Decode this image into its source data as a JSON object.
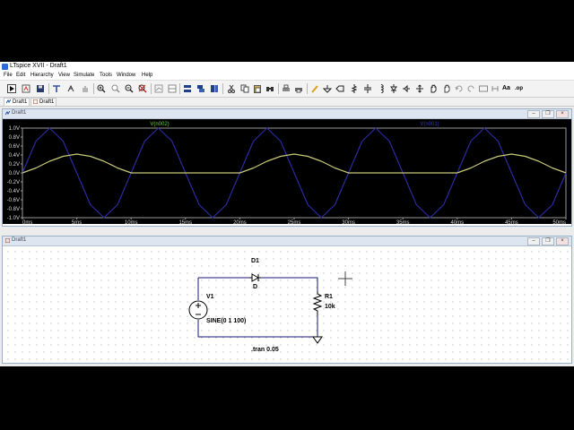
{
  "window": {
    "title": "LTspice XVII - Draft1",
    "brand_color": "#2b6cd4"
  },
  "menu": [
    "File",
    "Edit",
    "Hierarchy",
    "View",
    "Simulate",
    "Tools",
    "Window",
    "Help"
  ],
  "toolbar": {
    "icons": [
      "run-icon",
      "new-schematic-icon",
      "save-icon",
      "control-panel-icon",
      "halt-icon",
      "pan-icon",
      "zoom-in-icon",
      "zoom-area-icon",
      "zoom-out-icon",
      "zoom-fit-icon",
      "autorange-icon",
      "tile-horizontal-icon",
      "cascade-icon",
      "tile-vertical-icon",
      "cut-icon",
      "copy-icon",
      "paste-icon",
      "find-icon",
      "print-icon",
      "print-setup-icon",
      "draw-wire-icon",
      "ground-icon",
      "label-net-icon",
      "resistor-icon",
      "capacitor-icon",
      "inductor-icon",
      "diode-icon",
      "component-icon",
      "move-icon",
      "drag-icon",
      "undo-icon",
      "redo-icon",
      "rotate-icon",
      "mirror-icon",
      "text-icon",
      "spice-directive-icon"
    ],
    "text_glyphs": {
      "text": "Aa",
      "directive": ".op"
    }
  },
  "tabs": [
    "Draft1",
    "Draft1"
  ],
  "plot_window": {
    "title": "Draft1",
    "traces": [
      {
        "name": "V(n002)",
        "color": "#c8c878"
      },
      {
        "name": "V(n001)",
        "color": "#2a2aa0"
      }
    ],
    "background": "#000000"
  },
  "schematic_window": {
    "title": "Draft1",
    "components": {
      "diode_ref": "D1",
      "diode_model": "D",
      "source_ref": "V1",
      "source_value": "SINE(0 1 100)",
      "resistor_ref": "R1",
      "resistor_value": "10k"
    },
    "directive": ".tran 0.05"
  },
  "window_buttons": {
    "minimize": "–",
    "restore": "❐",
    "close": "×"
  },
  "chart_data": {
    "type": "line",
    "x": [
      0,
      1.25,
      2.5,
      3.75,
      5,
      6.25,
      7.5,
      8.75,
      10,
      11.25,
      12.5,
      13.75,
      15,
      16.25,
      17.5,
      18.75,
      20,
      21.25,
      22.5,
      23.75,
      25,
      26.25,
      27.5,
      28.75,
      30,
      31.25,
      32.5,
      33.75,
      35,
      36.25,
      37.5,
      38.75,
      40,
      41.25,
      42.5,
      43.75,
      45,
      46.25,
      47.5,
      48.75,
      50
    ],
    "xunit": "ms",
    "series": [
      {
        "name": "V(n002)",
        "color": "#c8c878",
        "values": [
          0,
          0.11,
          0.26,
          0.37,
          0.42,
          0.37,
          0.26,
          0.11,
          0,
          0,
          0,
          0,
          0,
          0,
          0,
          0,
          0,
          0.11,
          0.26,
          0.37,
          0.42,
          0.37,
          0.26,
          0.11,
          0,
          0,
          0,
          0,
          0,
          0,
          0,
          0,
          0,
          0.11,
          0.26,
          0.37,
          0.42,
          0.37,
          0.26,
          0.11,
          0
        ]
      },
      {
        "name": "V(n001)",
        "color": "#2a2aa0",
        "values": [
          0,
          0.71,
          1,
          0.71,
          0,
          -0.71,
          -1,
          -0.71,
          0,
          0.71,
          1,
          0.71,
          0,
          -0.71,
          -1,
          -0.71,
          0,
          0.71,
          1,
          0.71,
          0,
          -0.71,
          -1,
          -0.71,
          0,
          0.71,
          1,
          0.71,
          0,
          -0.71,
          -1,
          -0.71,
          0,
          0.71,
          1,
          0.71,
          0,
          -0.71,
          -1,
          -0.71,
          0
        ]
      }
    ],
    "xticks": [
      "0ms",
      "5ms",
      "10ms",
      "15ms",
      "20ms",
      "25ms",
      "30ms",
      "35ms",
      "40ms",
      "45ms",
      "50ms"
    ],
    "yticks": [
      "1.0V",
      "0.8V",
      "0.6V",
      "0.4V",
      "0.2V",
      "0.0V",
      "-0.2V",
      "-0.4V",
      "-0.6V",
      "-0.8V",
      "-1.0V"
    ],
    "xlim": [
      0,
      50
    ],
    "ylim": [
      -1,
      1
    ],
    "grid": false
  }
}
